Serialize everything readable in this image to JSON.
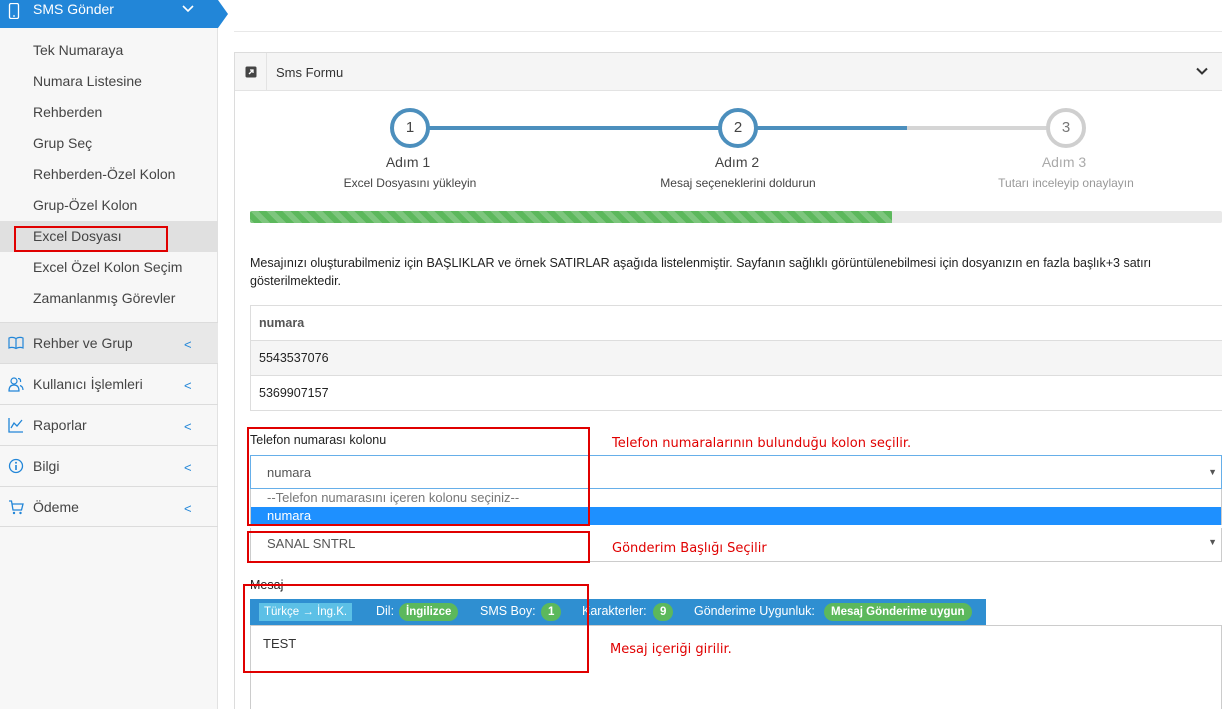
{
  "sidebar": {
    "active_menu": "SMS Gönder",
    "sub_items": [
      "Tek Numaraya",
      "Numara Listesine",
      "Rehberden",
      "Grup Seç",
      "Rehberden-Özel Kolon",
      "Grup-Özel Kolon",
      "Excel Dosyası",
      "Excel Özel Kolon Seçim",
      "Zamanlanmış Görevler"
    ],
    "groups": [
      {
        "label": "Rehber ve Grup",
        "icon": "book-icon"
      },
      {
        "label": "Kullanıcı İşlemleri",
        "icon": "users-icon"
      },
      {
        "label": "Raporlar",
        "icon": "chart-icon"
      },
      {
        "label": "Bilgi",
        "icon": "info-icon"
      },
      {
        "label": "Ödeme",
        "icon": "cart-icon"
      }
    ],
    "collapse_glyph": "<",
    "accent": "#2286d8"
  },
  "panel": {
    "title": "Sms Formu"
  },
  "stepper": {
    "steps": [
      {
        "num": "1",
        "title": "Adım 1",
        "desc": "Excel Dosyasını yükleyin"
      },
      {
        "num": "2",
        "title": "Adım 2",
        "desc": "Mesaj seçeneklerini doldurun"
      },
      {
        "num": "3",
        "title": "Adım 3",
        "desc": "Tutarı inceleyip onaylayın"
      }
    ],
    "progress_percent": 66
  },
  "info_text": "Mesajınızı oluşturabilmeniz için BAŞLIKLAR ve örnek SATIRLAR aşağıda listelenmiştir. Sayfanın sağlıklı görüntülenebilmesi için dosyanızın en fazla başlık+3 satırı gösterilmektedir.",
  "table": {
    "header": "numara",
    "rows": [
      "5543537076",
      "5369907157"
    ]
  },
  "phone_column": {
    "label": "Telefon numarası kolonu",
    "value": "numara",
    "options": [
      "--Telefon numarasını içeren kolonu seçiniz--",
      "numara"
    ]
  },
  "sender": {
    "value": "SANAL SNTRL"
  },
  "message": {
    "label": "Mesaj",
    "translit_button": "Türkçe → İng.K.",
    "lang_label": "Dil:",
    "lang_value": "İngilizce",
    "sms_label": "SMS Boy:",
    "sms_value": "1",
    "chars_label": "Karakterler:",
    "chars_value": "9",
    "fit_label": "Gönderime Uygunluk:",
    "fit_value": "Mesaj Gönderime uygun",
    "text": "TEST"
  },
  "annotations": {
    "phone": "Telefon numaralarının bulunduğu kolon seçilir.",
    "sender": "Gönderim Başlığı Seçilir",
    "message": "Mesaj içeriği girilir."
  }
}
